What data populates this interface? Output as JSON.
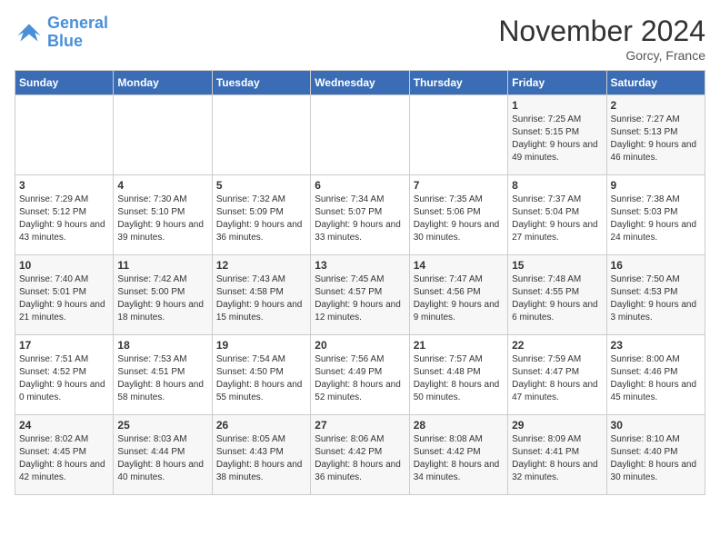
{
  "header": {
    "logo_line1": "General",
    "logo_line2": "Blue",
    "month_title": "November 2024",
    "location": "Gorcy, France"
  },
  "days_of_week": [
    "Sunday",
    "Monday",
    "Tuesday",
    "Wednesday",
    "Thursday",
    "Friday",
    "Saturday"
  ],
  "weeks": [
    [
      {
        "day": "",
        "info": ""
      },
      {
        "day": "",
        "info": ""
      },
      {
        "day": "",
        "info": ""
      },
      {
        "day": "",
        "info": ""
      },
      {
        "day": "",
        "info": ""
      },
      {
        "day": "1",
        "info": "Sunrise: 7:25 AM\nSunset: 5:15 PM\nDaylight: 9 hours and 49 minutes."
      },
      {
        "day": "2",
        "info": "Sunrise: 7:27 AM\nSunset: 5:13 PM\nDaylight: 9 hours and 46 minutes."
      }
    ],
    [
      {
        "day": "3",
        "info": "Sunrise: 7:29 AM\nSunset: 5:12 PM\nDaylight: 9 hours and 43 minutes."
      },
      {
        "day": "4",
        "info": "Sunrise: 7:30 AM\nSunset: 5:10 PM\nDaylight: 9 hours and 39 minutes."
      },
      {
        "day": "5",
        "info": "Sunrise: 7:32 AM\nSunset: 5:09 PM\nDaylight: 9 hours and 36 minutes."
      },
      {
        "day": "6",
        "info": "Sunrise: 7:34 AM\nSunset: 5:07 PM\nDaylight: 9 hours and 33 minutes."
      },
      {
        "day": "7",
        "info": "Sunrise: 7:35 AM\nSunset: 5:06 PM\nDaylight: 9 hours and 30 minutes."
      },
      {
        "day": "8",
        "info": "Sunrise: 7:37 AM\nSunset: 5:04 PM\nDaylight: 9 hours and 27 minutes."
      },
      {
        "day": "9",
        "info": "Sunrise: 7:38 AM\nSunset: 5:03 PM\nDaylight: 9 hours and 24 minutes."
      }
    ],
    [
      {
        "day": "10",
        "info": "Sunrise: 7:40 AM\nSunset: 5:01 PM\nDaylight: 9 hours and 21 minutes."
      },
      {
        "day": "11",
        "info": "Sunrise: 7:42 AM\nSunset: 5:00 PM\nDaylight: 9 hours and 18 minutes."
      },
      {
        "day": "12",
        "info": "Sunrise: 7:43 AM\nSunset: 4:58 PM\nDaylight: 9 hours and 15 minutes."
      },
      {
        "day": "13",
        "info": "Sunrise: 7:45 AM\nSunset: 4:57 PM\nDaylight: 9 hours and 12 minutes."
      },
      {
        "day": "14",
        "info": "Sunrise: 7:47 AM\nSunset: 4:56 PM\nDaylight: 9 hours and 9 minutes."
      },
      {
        "day": "15",
        "info": "Sunrise: 7:48 AM\nSunset: 4:55 PM\nDaylight: 9 hours and 6 minutes."
      },
      {
        "day": "16",
        "info": "Sunrise: 7:50 AM\nSunset: 4:53 PM\nDaylight: 9 hours and 3 minutes."
      }
    ],
    [
      {
        "day": "17",
        "info": "Sunrise: 7:51 AM\nSunset: 4:52 PM\nDaylight: 9 hours and 0 minutes."
      },
      {
        "day": "18",
        "info": "Sunrise: 7:53 AM\nSunset: 4:51 PM\nDaylight: 8 hours and 58 minutes."
      },
      {
        "day": "19",
        "info": "Sunrise: 7:54 AM\nSunset: 4:50 PM\nDaylight: 8 hours and 55 minutes."
      },
      {
        "day": "20",
        "info": "Sunrise: 7:56 AM\nSunset: 4:49 PM\nDaylight: 8 hours and 52 minutes."
      },
      {
        "day": "21",
        "info": "Sunrise: 7:57 AM\nSunset: 4:48 PM\nDaylight: 8 hours and 50 minutes."
      },
      {
        "day": "22",
        "info": "Sunrise: 7:59 AM\nSunset: 4:47 PM\nDaylight: 8 hours and 47 minutes."
      },
      {
        "day": "23",
        "info": "Sunrise: 8:00 AM\nSunset: 4:46 PM\nDaylight: 8 hours and 45 minutes."
      }
    ],
    [
      {
        "day": "24",
        "info": "Sunrise: 8:02 AM\nSunset: 4:45 PM\nDaylight: 8 hours and 42 minutes."
      },
      {
        "day": "25",
        "info": "Sunrise: 8:03 AM\nSunset: 4:44 PM\nDaylight: 8 hours and 40 minutes."
      },
      {
        "day": "26",
        "info": "Sunrise: 8:05 AM\nSunset: 4:43 PM\nDaylight: 8 hours and 38 minutes."
      },
      {
        "day": "27",
        "info": "Sunrise: 8:06 AM\nSunset: 4:42 PM\nDaylight: 8 hours and 36 minutes."
      },
      {
        "day": "28",
        "info": "Sunrise: 8:08 AM\nSunset: 4:42 PM\nDaylight: 8 hours and 34 minutes."
      },
      {
        "day": "29",
        "info": "Sunrise: 8:09 AM\nSunset: 4:41 PM\nDaylight: 8 hours and 32 minutes."
      },
      {
        "day": "30",
        "info": "Sunrise: 8:10 AM\nSunset: 4:40 PM\nDaylight: 8 hours and 30 minutes."
      }
    ]
  ]
}
